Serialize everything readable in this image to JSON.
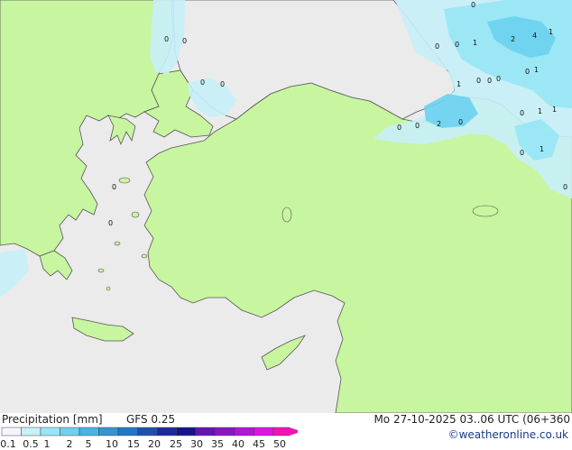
{
  "map": {
    "precip_values": [
      "0",
      "0",
      "0",
      "0",
      "0",
      "0",
      "1",
      "2",
      "4",
      "1",
      "0",
      "0",
      "1",
      "0",
      "0",
      "0",
      "1",
      "0",
      "1",
      "1",
      "0",
      "2",
      "0",
      "0",
      "0",
      "1",
      "0",
      "0",
      "0"
    ]
  },
  "footer": {
    "title": "Precipitation [mm]",
    "model": "GFS 0.25",
    "valid": "Mo 27-10-2025 03..06 UTC (06+360",
    "credit": "©weatheronline.co.uk"
  },
  "legend": {
    "colors": [
      "#f5f5ff",
      "#c8f0f8",
      "#96e6f5",
      "#6cd2f0",
      "#46b4e6",
      "#3296d2",
      "#1e78c8",
      "#1e50b4",
      "#1e28a0",
      "#14148c",
      "#6414b4",
      "#8c14c8",
      "#b414dc",
      "#dc14e6",
      "#f014b4"
    ],
    "ticks": [
      "0.1",
      "0.5",
      "1",
      "2",
      "5",
      "10",
      "15",
      "20",
      "25",
      "30",
      "35",
      "40",
      "45",
      "50"
    ]
  },
  "colors": {
    "land": "#c8f5a0",
    "sea": "#ebebeb",
    "coast": "#555555"
  }
}
